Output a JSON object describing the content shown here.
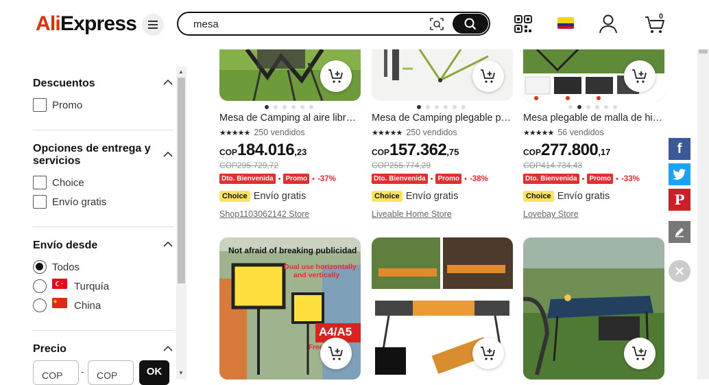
{
  "header": {
    "logo": {
      "part1": "Ali",
      "part2": "Express"
    },
    "search": {
      "value": "mesa"
    },
    "cart_count": "0",
    "country_flag_colors": [
      "#fcd116",
      "#003893",
      "#ce1126"
    ]
  },
  "filters": {
    "discounts": {
      "title": "Descuentos",
      "options": [
        "Promo"
      ]
    },
    "delivery": {
      "title": "Opciones de entrega y servicios",
      "options": [
        "Choice",
        "Envío gratis"
      ]
    },
    "ship_from": {
      "title": "Envío desde",
      "options": [
        "Todos",
        "Turquía",
        "China"
      ],
      "selected": "Todos"
    },
    "price": {
      "title": "Precio",
      "min_placeholder": "COP",
      "max_placeholder": "COP",
      "separator": "-",
      "ok_label": "OK"
    }
  },
  "products": [
    {
      "title": "Mesa de Camping al aire libre plegable",
      "stars": "★★★★★",
      "sold": "250 vendidos",
      "currency": "COP",
      "price_int": "184.016",
      "price_dec": ",23",
      "old_price": "COP295.729,72",
      "badge1": "Dto. Bienvenida",
      "badge2": "Promo",
      "discount": "-37%",
      "choice": "Choice",
      "shipping": "Envío gratis",
      "store": "Shop1103062142 Store"
    },
    {
      "title": "Mesa de Camping plegable portátil",
      "stars": "★★★★★",
      "sold": "250 vendidos",
      "currency": "COP",
      "price_int": "157.362",
      "price_dec": ",75",
      "old_price": "COP255.774,29",
      "badge1": "Dto. Bienvenida",
      "badge2": "Promo",
      "discount": "-38%",
      "choice": "Choice",
      "shipping": "Envío gratis",
      "store": "Liveable Home Store"
    },
    {
      "title": "Mesa plegable de malla de hierro",
      "stars": "★★★★★",
      "sold": "56 vendidos",
      "currency": "COP",
      "price_int": "277.800",
      "price_dec": ",17",
      "old_price": "COP414.734,43",
      "badge1": "Dto. Bienvenida",
      "badge2": "Promo",
      "discount": "-33%",
      "choice": "Choice",
      "shipping": "Envío gratis",
      "store": "Lovebay Store"
    }
  ],
  "product_images_row2": {
    "p4_overlay1": "Not afraid of breaking publicidad",
    "p4_overlay2": "Dual use horizontally",
    "p4_overlay3": "and vertically",
    "p4_overlay4": "A4/A5",
    "p4_overlay5": "Free"
  },
  "social": [
    "facebook-icon",
    "twitter-icon",
    "pinterest-icon",
    "edit-icon",
    "close-icon"
  ]
}
